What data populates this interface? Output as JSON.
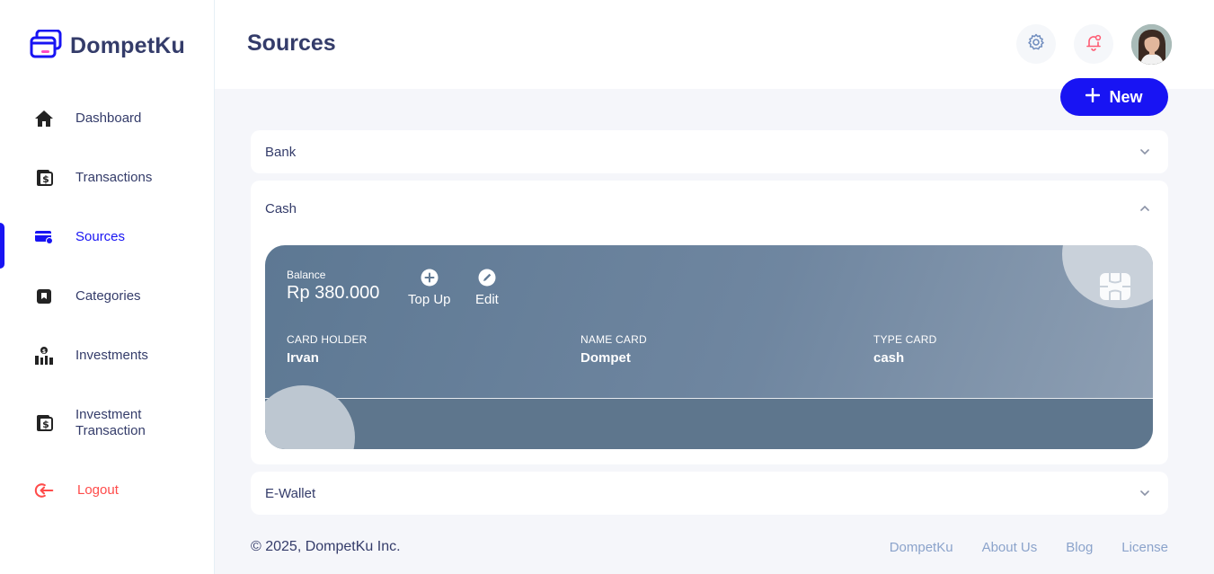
{
  "app": {
    "brand_name": "DompetKu",
    "accent_color": "#1814f3",
    "logout_color": "#ff4b4a"
  },
  "sidebar": {
    "items": [
      {
        "label": "Dashboard",
        "icon": "home-icon"
      },
      {
        "label": "Transactions",
        "icon": "transaction-icon"
      },
      {
        "label": "Sources",
        "icon": "credit-card-icon",
        "active": true
      },
      {
        "label": "Categories",
        "icon": "bookmark-icon"
      },
      {
        "label": "Investments",
        "icon": "investment-icon"
      },
      {
        "label": "Investment Transaction",
        "icon": "transaction-icon"
      }
    ],
    "logout_label": "Logout"
  },
  "header": {
    "title": "Sources",
    "settings_icon": "gear-icon",
    "notification_icon": "bell-icon"
  },
  "main": {
    "new_button_label": "New",
    "sections": [
      {
        "title": "Bank",
        "expanded": false
      },
      {
        "title": "Cash",
        "expanded": true
      },
      {
        "title": "E-Wallet",
        "expanded": false
      }
    ],
    "card": {
      "balance_label": "Balance",
      "balance_value": "Rp 380.000",
      "topup_label": "Top Up",
      "edit_label": "Edit",
      "holder_label": "CARD HOLDER",
      "holder_value": "Irvan",
      "name_label": "NAME CARD",
      "name_value": "Dompet",
      "type_label": "TYPE CARD",
      "type_value": "cash"
    }
  },
  "footer": {
    "copyright": "© 2025, DompetKu Inc.",
    "links": [
      "DompetKu",
      "About Us",
      "Blog",
      "License"
    ]
  }
}
